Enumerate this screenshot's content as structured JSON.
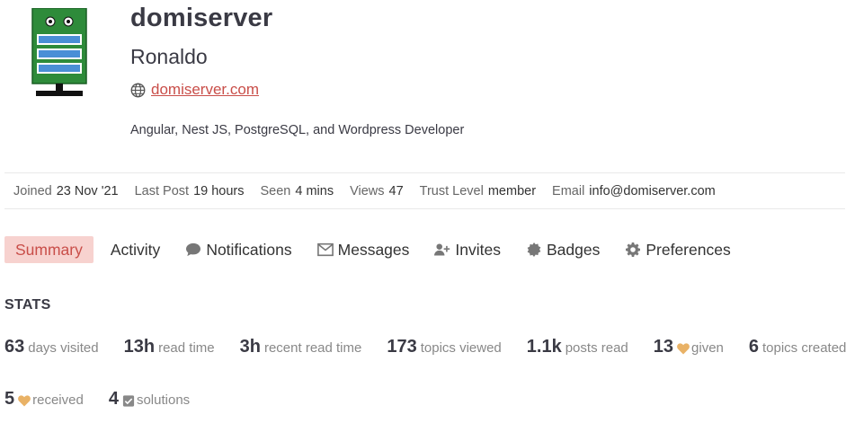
{
  "profile": {
    "username": "domiserver",
    "name": "Ronaldo",
    "website": "domiserver.com",
    "bio": "Angular, Nest JS, PostgreSQL, and Wordpress Developer"
  },
  "meta": [
    {
      "label": "Joined",
      "value": "23 Nov '21"
    },
    {
      "label": "Last Post",
      "value": "19 hours"
    },
    {
      "label": "Seen",
      "value": "4 mins"
    },
    {
      "label": "Views",
      "value": "47"
    },
    {
      "label": "Trust Level",
      "value": "member"
    },
    {
      "label": "Email",
      "value": "info@domiserver.com"
    }
  ],
  "nav": [
    {
      "label": "Summary",
      "icon": "none",
      "active": true
    },
    {
      "label": "Activity",
      "icon": "none"
    },
    {
      "label": "Notifications",
      "icon": "comment-icon"
    },
    {
      "label": "Messages",
      "icon": "envelope-icon"
    },
    {
      "label": "Invites",
      "icon": "user-plus-icon"
    },
    {
      "label": "Badges",
      "icon": "badge-icon"
    },
    {
      "label": "Preferences",
      "icon": "gear-icon"
    }
  ],
  "stats": {
    "title": "STATS",
    "days_visited": {
      "value": "63",
      "label": "days visited"
    },
    "read_time": {
      "value": "13h",
      "label": "read time"
    },
    "recent_read_time": {
      "value": "3h",
      "label": "recent read time"
    },
    "topics_viewed": {
      "value": "173",
      "label": "topics viewed"
    },
    "posts_read": {
      "value": "1.1k",
      "label": "posts read"
    },
    "likes_given": {
      "value": "13",
      "label": "given",
      "icon": "heart-icon"
    },
    "topics_created": {
      "value": "6",
      "label": "topics created"
    },
    "likes_received": {
      "value": "5",
      "label": "received",
      "icon": "heart-icon"
    },
    "solutions": {
      "value": "4",
      "label": "solutions",
      "icon": "check-square-icon"
    }
  },
  "colors": {
    "accent": "#c94e49",
    "accent_bg": "#f7d2cf",
    "heart": "#e9b266",
    "avatar_green": "#2e8b3a",
    "avatar_blue": "#4a8fd6"
  }
}
